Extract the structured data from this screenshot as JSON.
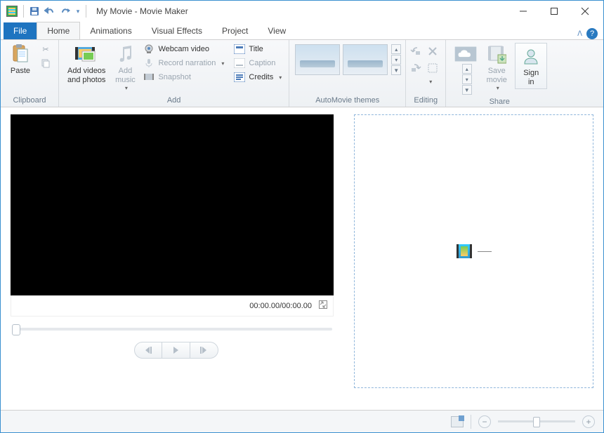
{
  "title": "My Movie - Movie Maker",
  "tabs": {
    "file": "File",
    "home": "Home",
    "animations": "Animations",
    "visual_effects": "Visual Effects",
    "project": "Project",
    "view": "View"
  },
  "ribbon": {
    "clipboard": {
      "label": "Clipboard",
      "paste": "Paste"
    },
    "add": {
      "label": "Add",
      "add_videos_photos": "Add videos\nand photos",
      "add_music": "Add\nmusic",
      "webcam_video": "Webcam video",
      "record_narration": "Record narration",
      "snapshot": "Snapshot",
      "title": "Title",
      "caption": "Caption",
      "credits": "Credits"
    },
    "automovie": {
      "label": "AutoMovie themes"
    },
    "editing": {
      "label": "Editing"
    },
    "share": {
      "label": "Share",
      "save_movie": "Save\nmovie",
      "sign_in": "Sign\nin"
    }
  },
  "preview": {
    "timecode": "00:00.00/00:00.00"
  }
}
